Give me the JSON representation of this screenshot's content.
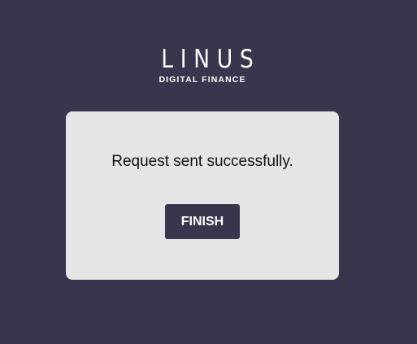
{
  "brand": {
    "name": "LINUS",
    "tagline": "DIGITAL FINANCE"
  },
  "dialog": {
    "message": "Request sent successfully.",
    "finish_label": "FINISH"
  },
  "colors": {
    "background": "#38364d",
    "card": "#e5e5e5",
    "button": "#38364d",
    "button_text": "#ffffff"
  }
}
